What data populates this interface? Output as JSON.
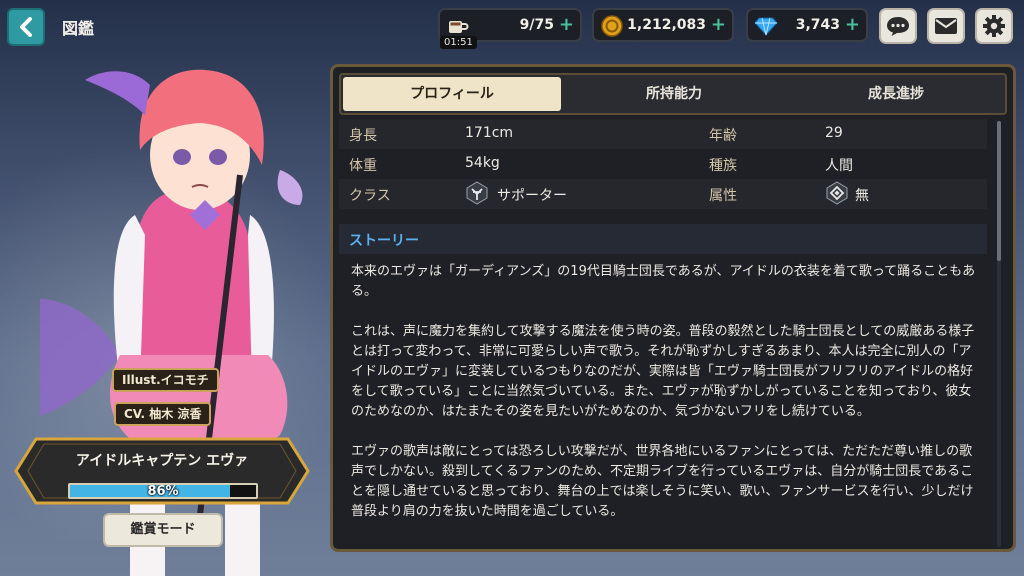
{
  "header": {
    "title": "図鑑",
    "stamina": "9/75",
    "stamina_timer": "01:51",
    "gold": "1,212,083",
    "gems": "3,743"
  },
  "character": {
    "illust_credit": "Illust.イコモチ",
    "cv_credit": "CV. 柚木 涼香",
    "name": "アイドルキャプテン エヴァ",
    "affinity_percent": "86%",
    "affinity_fraction": 0.86,
    "view_mode_label": "鑑賞モード"
  },
  "tabs": [
    {
      "label": "プロフィール",
      "active": true
    },
    {
      "label": "所持能力",
      "active": false
    },
    {
      "label": "成長進捗",
      "active": false
    }
  ],
  "profile": {
    "height_label": "身長",
    "height": "171cm",
    "age_label": "年齢",
    "age": "29",
    "weight_label": "体重",
    "weight": "54kg",
    "race_label": "種族",
    "race": "人間",
    "class_label": "クラス",
    "class": "サポーター",
    "attribute_label": "属性",
    "attribute": "無"
  },
  "story": {
    "heading": "ストーリー",
    "paragraphs": [
      "本来のエヴァは「ガーディアンズ」の19代目騎士団長であるが、アイドルの衣装を着て歌って踊ることもある。",
      "これは、声に魔力を集約して攻撃する魔法を使う時の姿。普段の毅然とした騎士団長としての威厳ある様子とは打って変わって、非常に可愛らしい声で歌う。それが恥ずかしすぎるあまり、本人は完全に別人の「アイドルのエヴァ」に変装しているつもりなのだが、実際は皆「エヴァ騎士団長がフリフリのアイドルの格好をして歌っている」ことに当然気づいている。また、エヴァが恥ずかしがっていることを知っており、彼女のためなのか、はたまたその姿を見たいがためなのか、気づかないフリをし続けている。",
      "エヴァの歌声は敵にとっては恐ろしい攻撃だが、世界各地にいるファンにとっては、ただただ尊い推しの歌声でしかない。殺到してくるファンのため、不定期ライブを行っているエヴァは、自分が騎士団長であることを隠し通せていると思っており、舞台の上では楽しそうに笑い、歌い、ファンサービスを行い、少しだけ普段より肩の力を抜いた時間を過ごしている。"
    ]
  },
  "colors": {
    "accent_blue": "#5cb2ee",
    "affinity_bar": "#42b4e6",
    "plus_green": "#49c29a",
    "panel_border": "#6a5a3c"
  },
  "icons": [
    "back-arrow-icon",
    "coffee-cup-icon",
    "gold-coin-icon",
    "diamond-gem-icon",
    "chat-bubble-icon",
    "mail-icon",
    "gear-icon",
    "supporter-class-icon",
    "neutral-attribute-icon"
  ]
}
